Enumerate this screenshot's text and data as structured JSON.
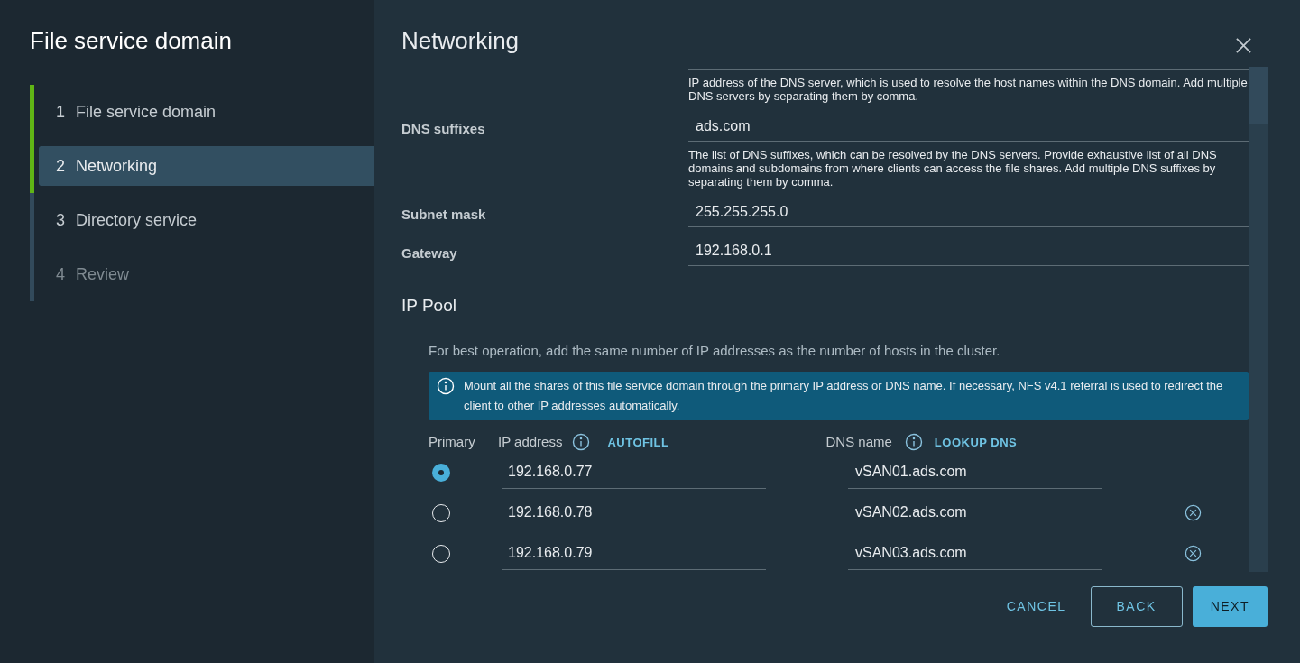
{
  "wizard": {
    "title": "File service domain"
  },
  "steps": [
    {
      "number": "1",
      "label": "File service domain",
      "selected": false,
      "done": true,
      "disabled": false
    },
    {
      "number": "2",
      "label": "Networking",
      "selected": true,
      "done": true,
      "disabled": false
    },
    {
      "number": "3",
      "label": "Directory service",
      "selected": false,
      "done": false,
      "disabled": false
    },
    {
      "number": "4",
      "label": "Review",
      "selected": false,
      "done": false,
      "disabled": true
    }
  ],
  "page": {
    "title": "Networking"
  },
  "dns_servers_help": "IP address of the DNS server, which is used to resolve the host names within the DNS domain. Add multiple DNS servers by separating them by comma.",
  "fields": [
    {
      "label": "DNS suffixes",
      "value": "ads.com",
      "help": "The list of DNS suffixes, which can be resolved by the DNS servers. Provide exhaustive list of all DNS domains and subdomains from where clients can access the file shares. Add multiple DNS suffixes by separating them by comma."
    },
    {
      "label": "Subnet mask",
      "value": "255.255.255.0"
    },
    {
      "label": "Gateway",
      "value": "192.168.0.1"
    }
  ],
  "ip_pool": {
    "title": "IP Pool",
    "description": "For best operation, add the same number of IP addresses as the number of hosts in the cluster.",
    "alert": "Mount all the shares of this file service domain through the primary IP address or DNS name. If necessary, NFS v4.1 referral is used to redirect the client to other IP addresses automatically.",
    "columns": {
      "primary": "Primary",
      "ip": "IP address",
      "autofill": "AUTOFILL",
      "dns": "DNS name",
      "lookup": "LOOKUP DNS"
    },
    "rows": [
      {
        "selected": true,
        "ip": "192.168.0.77",
        "dns": "vSAN01.ads.com",
        "removable": false
      },
      {
        "selected": false,
        "ip": "192.168.0.78",
        "dns": "vSAN02.ads.com",
        "removable": true
      },
      {
        "selected": false,
        "ip": "192.168.0.79",
        "dns": "vSAN03.ads.com",
        "removable": true
      }
    ]
  },
  "buttons": [
    {
      "kind": "flat",
      "label": "CANCEL"
    },
    {
      "kind": "outline",
      "label": "BACK"
    },
    {
      "kind": "primary",
      "label": "NEXT"
    }
  ]
}
